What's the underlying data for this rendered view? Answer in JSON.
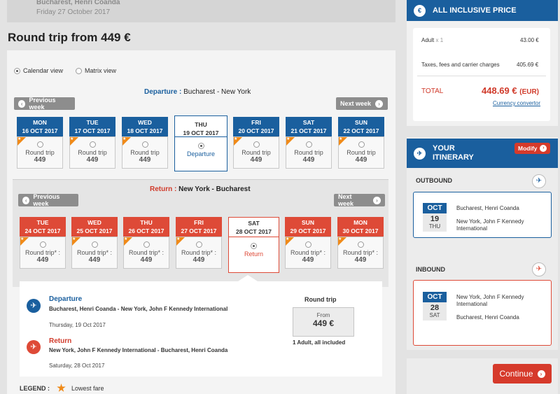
{
  "top": {
    "route": "Bucharest, Henri Coanda",
    "date": "Friday 27 October 2017"
  },
  "title": "Round trip from 449 €",
  "view": {
    "calendar": "Calendar view",
    "matrix": "Matrix view"
  },
  "departure": {
    "label": "Departure :",
    "route": "Bucharest - New York",
    "prev_week": "Previous week",
    "next_week": "Next week",
    "days": [
      {
        "dow": "MON",
        "date": "16 OCT 2017",
        "type": "Round trip",
        "price": "449"
      },
      {
        "dow": "TUE",
        "date": "17 OCT 2017",
        "type": "Round trip",
        "price": "449"
      },
      {
        "dow": "WED",
        "date": "18 OCT 2017",
        "type": "Round trip",
        "price": "449"
      },
      {
        "dow": "THU",
        "date": "19 OCT 2017",
        "type": "Departure",
        "price": ""
      },
      {
        "dow": "FRI",
        "date": "20 OCT 2017",
        "type": "Round trip",
        "price": "449"
      },
      {
        "dow": "SAT",
        "date": "21 OCT 2017",
        "type": "Round trip",
        "price": "449"
      },
      {
        "dow": "SUN",
        "date": "22 OCT 2017",
        "type": "Round trip",
        "price": "449"
      }
    ]
  },
  "return": {
    "label": "Return :",
    "route": "New York - Bucharest",
    "prev_week": "Previous week",
    "next_week": "Next week",
    "days": [
      {
        "dow": "TUE",
        "date": "24 OCT 2017",
        "type": "Round trip* :",
        "price": "449"
      },
      {
        "dow": "WED",
        "date": "25 OCT 2017",
        "type": "Round trip* :",
        "price": "449"
      },
      {
        "dow": "THU",
        "date": "26 OCT 2017",
        "type": "Round trip* :",
        "price": "449"
      },
      {
        "dow": "FRI",
        "date": "27 OCT 2017",
        "type": "Round trip* :",
        "price": "449"
      },
      {
        "dow": "SAT",
        "date": "28 OCT 2017",
        "type": "Return",
        "price": ""
      },
      {
        "dow": "SUN",
        "date": "29 OCT 2017",
        "type": "Round trip* :",
        "price": "449"
      },
      {
        "dow": "MON",
        "date": "30 OCT 2017",
        "type": "Round trip* :",
        "price": "449"
      }
    ]
  },
  "summary": {
    "dep_title": "Departure",
    "dep_route": "Bucharest, Henri Coanda - New York, John F Kennedy International",
    "dep_date": "Thursday, 19 Oct 2017",
    "ret_title": "Return",
    "ret_route": "New York, John F Kennedy International - Bucharest, Henri Coanda",
    "ret_date": "Saturday, 28 Oct 2017",
    "rt_label": "Round trip",
    "from": "From",
    "price": "449 €",
    "note": "1 Adult, all included"
  },
  "legend": {
    "label": "LEGEND :",
    "lowest": "Lowest fare"
  },
  "price_panel": {
    "title": "ALL INCLUSIVE PRICE",
    "adult_label": "Adult",
    "adult_count": "x 1",
    "adult_price": "43.00 €",
    "taxes_label": "Taxes, fees and carrier charges",
    "taxes_price": "405.69 €",
    "total_label": "TOTAL",
    "total_value": "448.69 €",
    "total_currency": "(EUR)",
    "convertor": "Currency convertor"
  },
  "itinerary": {
    "title_1": "YOUR",
    "title_2": "ITINERARY",
    "modify": "Modify",
    "outbound_label": "OUTBOUND",
    "out_month": "OCT",
    "out_day": "19",
    "out_dow": "THU",
    "out_from": "Bucharest, Henri Coanda",
    "out_to": "New York, John F Kennedy International",
    "inbound_label": "INBOUND",
    "in_month": "OCT",
    "in_day": "28",
    "in_dow": "SAT",
    "in_from": "New York, John F Kennedy International",
    "in_to": "Bucharest, Henri Coanda"
  },
  "continue": "Continue"
}
